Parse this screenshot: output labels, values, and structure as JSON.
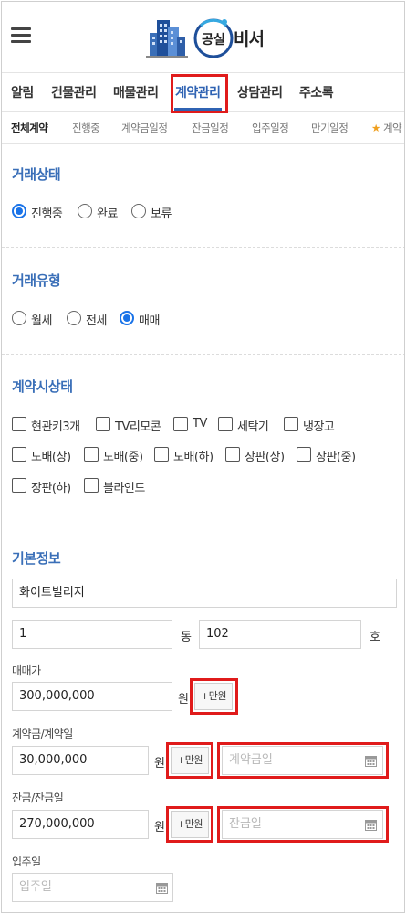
{
  "header": {
    "logo_text": "공실",
    "logo_suffix": "비서"
  },
  "main_tabs": [
    "알림",
    "건물관리",
    "매물관리",
    "계약관리",
    "상담관리",
    "주소록"
  ],
  "sub_tabs": [
    "전체계약",
    "진행중",
    "계약금일정",
    "잔금일정",
    "입주일정",
    "만기일정",
    "계약"
  ],
  "sub_tab_star": "★",
  "deal_status": {
    "title": "거래상태",
    "options": [
      "진행중",
      "완료",
      "보류"
    ],
    "selected": "진행중"
  },
  "deal_type": {
    "title": "거래유형",
    "options": [
      "월세",
      "전세",
      "매매"
    ],
    "selected": "매매"
  },
  "contract_state": {
    "title": "계약시상태",
    "options": [
      "현관키3개",
      "TV리모콘",
      "TV",
      "세탁기",
      "냉장고",
      "도배(상)",
      "도배(중)",
      "도배(하)",
      "장판(상)",
      "장판(중)",
      "장판(하)",
      "블라인드"
    ]
  },
  "basic_info": {
    "title": "기본정보",
    "building_name": "화이트빌리지",
    "dong_value": "1",
    "dong_unit": "동",
    "ho_value": "102",
    "ho_unit": "호",
    "sale_price_label": "매매가",
    "sale_price": "300,000,000",
    "won": "원",
    "add_manwon": "+만원",
    "deposit_label": "계약금/계약일",
    "deposit": "30,000,000",
    "deposit_date_placeholder": "계약금일",
    "balance_label": "잔금/잔금일",
    "balance": "270,000,000",
    "balance_date_placeholder": "잔금일",
    "move_in_label": "입주일",
    "move_in_placeholder": "입주일"
  },
  "colors": {
    "accent": "#2f63b3",
    "radio_checked": "#1a73e8",
    "highlight": "#e01b1b",
    "star": "#f0a020"
  }
}
